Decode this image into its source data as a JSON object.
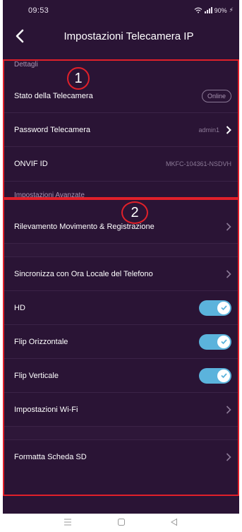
{
  "status_bar": {
    "time": "09:53",
    "battery": "90%",
    "icons": [
      "wifi-icon",
      "signal-icon",
      "bolt-icon"
    ]
  },
  "header": {
    "title": "Impostazioni Telecamera IP",
    "back_icon": "back-chevron-icon"
  },
  "sections": {
    "details": {
      "label": "Dettagli",
      "marker": "1",
      "camera_status": {
        "label": "Stato della Telecamera",
        "value": "Online"
      },
      "camera_password": {
        "label": "Password Telecamera",
        "value": "admin1"
      },
      "onvif": {
        "label": "ONVIF ID",
        "value": "MKFC-104361-NSDVH"
      }
    },
    "advanced": {
      "label": "Impostazioni Avanzate",
      "marker": "2",
      "motion": {
        "label": "Rilevamento Movimento & Registrazione"
      },
      "sync_time": {
        "label": "Sincronizza con Ora Locale del Telefono"
      },
      "hd": {
        "label": "HD",
        "on": true
      },
      "flip_h": {
        "label": "Flip Orizzontale",
        "on": true
      },
      "flip_v": {
        "label": "Flip Verticale",
        "on": true
      },
      "wifi": {
        "label": "Impostazioni Wi-Fi"
      },
      "format_sd": {
        "label": "Formatta Scheda SD"
      }
    }
  },
  "colors": {
    "background": "#2a1435",
    "toggle_on": "#5bb3dc",
    "highlight_box": "#e0202a"
  },
  "nav": {
    "icons": [
      "menu-icon",
      "home-icon",
      "back-triangle-icon"
    ]
  }
}
